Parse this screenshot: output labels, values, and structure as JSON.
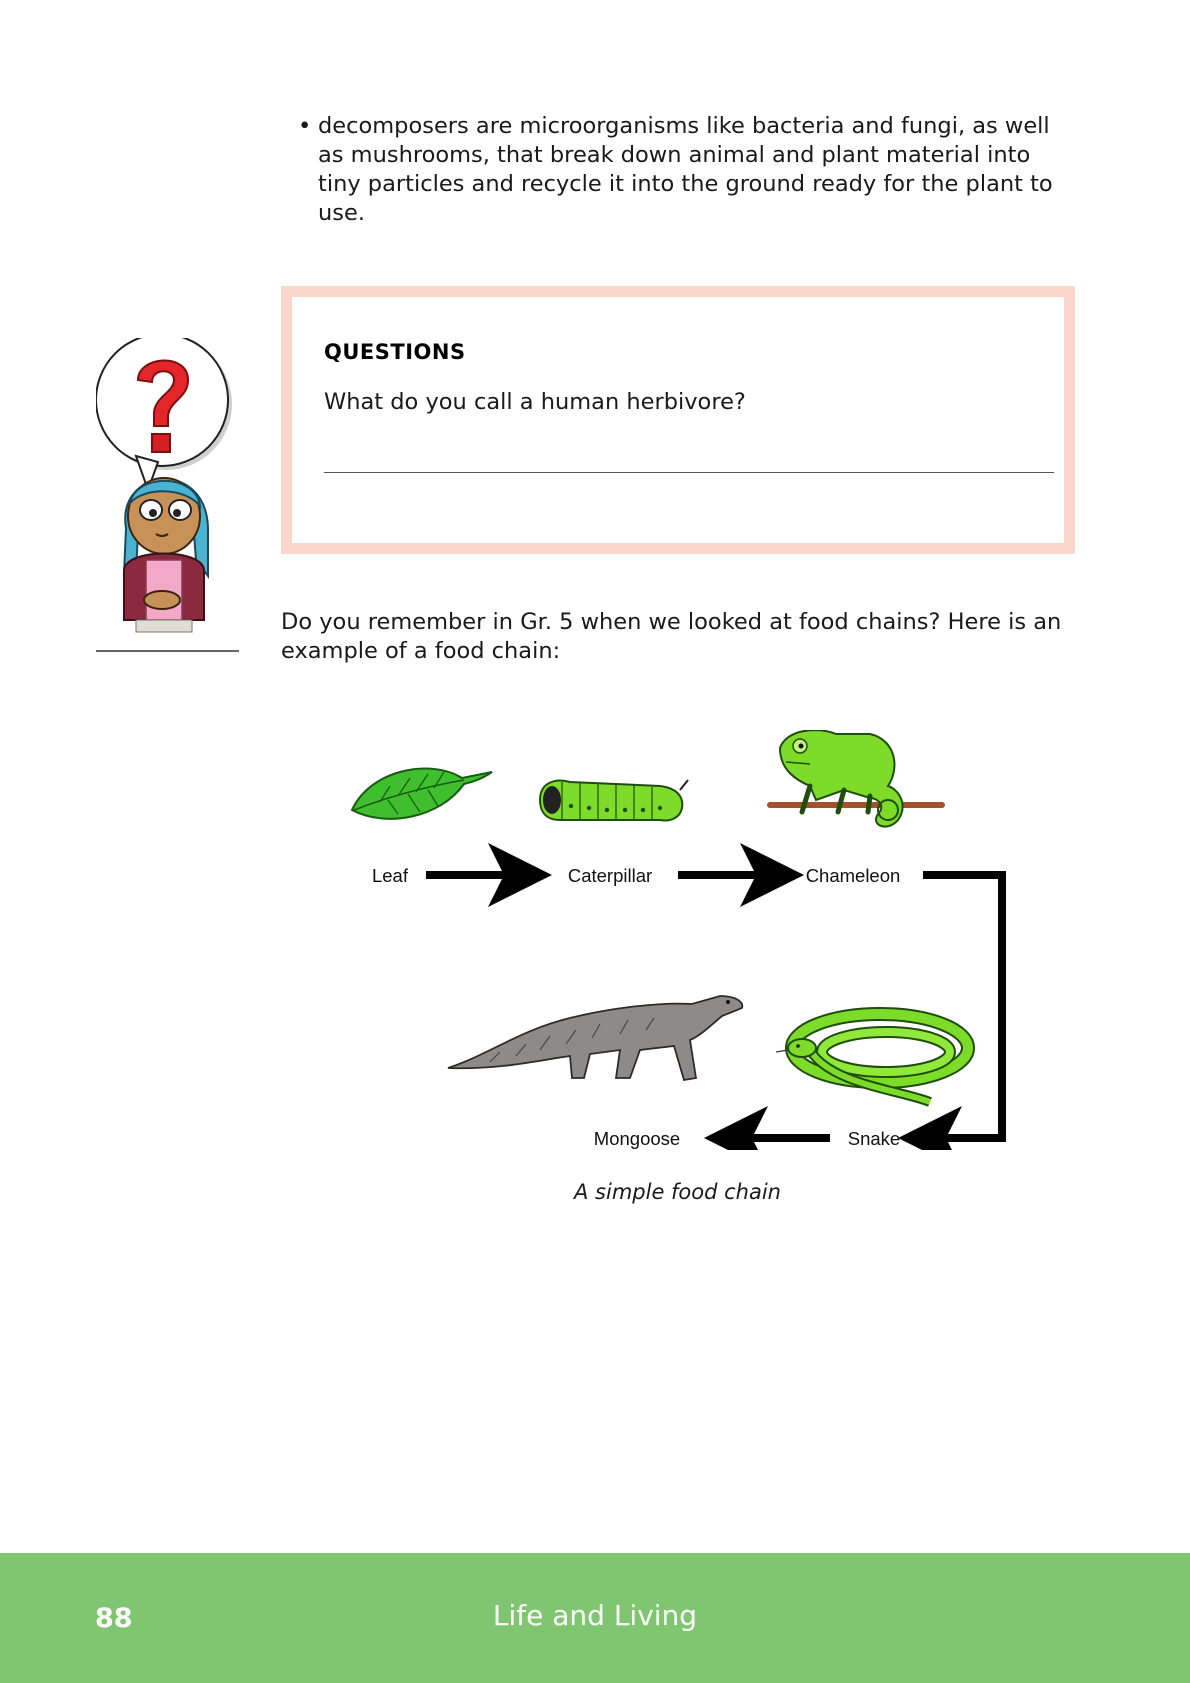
{
  "bullet": {
    "text": "decomposers are microorganisms like bacteria and fungi, as well as mushrooms, that break down animal and plant material into tiny particles and recycle it into the ground ready for the plant to use."
  },
  "questions": {
    "title": "QUESTIONS",
    "text": "What do you call a human herbivore?"
  },
  "intro": {
    "text": "Do you remember in Gr. 5 when we looked at food chains? Here is an example of a food chain:"
  },
  "food_chain": {
    "labels": {
      "leaf": "Leaf",
      "caterpillar": "Caterpillar",
      "chameleon": "Chameleon",
      "snake": "Snake",
      "mongoose": "Mongoose"
    },
    "caption": "A simple food chain"
  },
  "footer": {
    "page_number": "88",
    "title": "Life and Living"
  },
  "colors": {
    "box_border": "#fbd6cb",
    "footer_green": "#80c671",
    "lime": "#7ddb2a"
  }
}
